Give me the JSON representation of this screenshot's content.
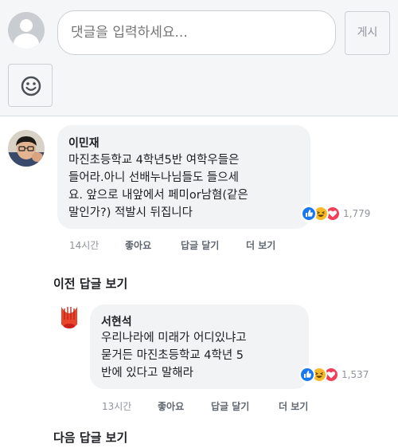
{
  "composer": {
    "placeholder": "댓글을 입력하세요...",
    "post_label": "게시"
  },
  "comments": [
    {
      "author": "이민재",
      "lines": [
        "마진초등학교 4학년5반 여학우들은",
        "들어라.아니 선배누나님들도 들으세",
        "요. 앞으로 내앞에서 페미or남혐(같은",
        "말인가?) 적발시 뒤집니다"
      ],
      "reaction_count": "1,779",
      "time": "14시간",
      "like_label": "좋아요",
      "reply_label": "답글 달기",
      "more_label": "더 보기"
    }
  ],
  "prev_replies_label": "이전 답글 보기",
  "replies": [
    {
      "author": "서현석",
      "lines": [
        "우리나라에 미래가 어디있냐고",
        "묻거든 마진초등학교 4학년 5",
        "반에 있다고 말해라"
      ],
      "reaction_count": "1,537",
      "time": "13시간",
      "like_label": "좋아요",
      "reply_label": "답글 달기",
      "more_label": "더 보기"
    }
  ],
  "next_replies_label": "다음 답글 보기",
  "colors": {
    "like": "#1877f2",
    "haha": "#f7b928",
    "love": "#f33e58"
  }
}
